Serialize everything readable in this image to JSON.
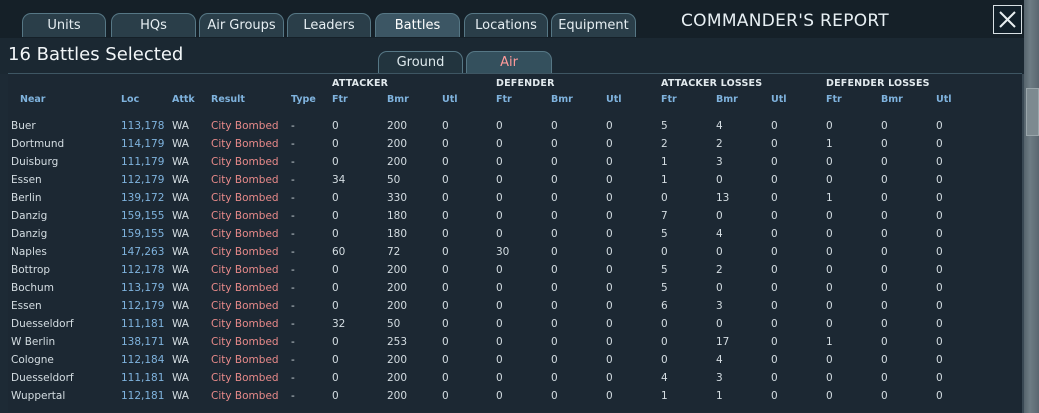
{
  "tabs": [
    {
      "label": "Units"
    },
    {
      "label": "HQs"
    },
    {
      "label": "Air Groups"
    },
    {
      "label": "Leaders"
    },
    {
      "label": "Battles"
    },
    {
      "label": "Locations"
    },
    {
      "label": "Equipment"
    }
  ],
  "active_tab": "Battles",
  "title": "COMMANDER'S REPORT",
  "selected_count": "16 Battles Selected",
  "subtabs": [
    {
      "label": "Ground"
    },
    {
      "label": "Air"
    }
  ],
  "active_subtab": "Air",
  "group_headers": {
    "attacker": "ATTACKER",
    "defender": "DEFENDER",
    "attacker_losses": "ATTACKER LOSSES",
    "defender_losses": "DEFENDER LOSSES"
  },
  "columns": {
    "near": "Near",
    "loc": "Loc",
    "attk": "Attk",
    "result": "Result",
    "type": "Type",
    "a_ftr": "Ftr",
    "a_bmr": "Bmr",
    "a_utl": "Utl",
    "d_ftr": "Ftr",
    "d_bmr": "Bmr",
    "d_utl": "Utl",
    "al_ftr": "Ftr",
    "al_bmr": "Bmr",
    "al_utl": "Utl",
    "dl_ftr": "Ftr",
    "dl_bmr": "Bmr",
    "dl_utl": "Utl"
  },
  "rows": [
    {
      "near": "Buer",
      "loc": "113,178",
      "attk": "WA",
      "result": "City Bombed",
      "type": "-",
      "a_ftr": "0",
      "a_bmr": "200",
      "a_utl": "0",
      "d_ftr": "0",
      "d_bmr": "0",
      "d_utl": "0",
      "al_ftr": "5",
      "al_bmr": "4",
      "al_utl": "0",
      "dl_ftr": "0",
      "dl_bmr": "0",
      "dl_utl": "0"
    },
    {
      "near": "Dortmund",
      "loc": "114,179",
      "attk": "WA",
      "result": "City Bombed",
      "type": "-",
      "a_ftr": "0",
      "a_bmr": "200",
      "a_utl": "0",
      "d_ftr": "0",
      "d_bmr": "0",
      "d_utl": "0",
      "al_ftr": "2",
      "al_bmr": "2",
      "al_utl": "0",
      "dl_ftr": "1",
      "dl_bmr": "0",
      "dl_utl": "0"
    },
    {
      "near": "Duisburg",
      "loc": "111,179",
      "attk": "WA",
      "result": "City Bombed",
      "type": "-",
      "a_ftr": "0",
      "a_bmr": "200",
      "a_utl": "0",
      "d_ftr": "0",
      "d_bmr": "0",
      "d_utl": "0",
      "al_ftr": "1",
      "al_bmr": "3",
      "al_utl": "0",
      "dl_ftr": "0",
      "dl_bmr": "0",
      "dl_utl": "0"
    },
    {
      "near": "Essen",
      "loc": "112,179",
      "attk": "WA",
      "result": "City Bombed",
      "type": "-",
      "a_ftr": "34",
      "a_bmr": "50",
      "a_utl": "0",
      "d_ftr": "0",
      "d_bmr": "0",
      "d_utl": "0",
      "al_ftr": "1",
      "al_bmr": "0",
      "al_utl": "0",
      "dl_ftr": "0",
      "dl_bmr": "0",
      "dl_utl": "0"
    },
    {
      "near": "Berlin",
      "loc": "139,172",
      "attk": "WA",
      "result": "City Bombed",
      "type": "-",
      "a_ftr": "0",
      "a_bmr": "330",
      "a_utl": "0",
      "d_ftr": "0",
      "d_bmr": "0",
      "d_utl": "0",
      "al_ftr": "0",
      "al_bmr": "13",
      "al_utl": "0",
      "dl_ftr": "1",
      "dl_bmr": "0",
      "dl_utl": "0"
    },
    {
      "near": "Danzig",
      "loc": "159,155",
      "attk": "WA",
      "result": "City Bombed",
      "type": "-",
      "a_ftr": "0",
      "a_bmr": "180",
      "a_utl": "0",
      "d_ftr": "0",
      "d_bmr": "0",
      "d_utl": "0",
      "al_ftr": "7",
      "al_bmr": "0",
      "al_utl": "0",
      "dl_ftr": "0",
      "dl_bmr": "0",
      "dl_utl": "0"
    },
    {
      "near": "Danzig",
      "loc": "159,155",
      "attk": "WA",
      "result": "City Bombed",
      "type": "-",
      "a_ftr": "0",
      "a_bmr": "180",
      "a_utl": "0",
      "d_ftr": "0",
      "d_bmr": "0",
      "d_utl": "0",
      "al_ftr": "5",
      "al_bmr": "4",
      "al_utl": "0",
      "dl_ftr": "0",
      "dl_bmr": "0",
      "dl_utl": "0"
    },
    {
      "near": "Naples",
      "loc": "147,263",
      "attk": "WA",
      "result": "City Bombed",
      "type": "-",
      "a_ftr": "60",
      "a_bmr": "72",
      "a_utl": "0",
      "d_ftr": "30",
      "d_bmr": "0",
      "d_utl": "0",
      "al_ftr": "0",
      "al_bmr": "0",
      "al_utl": "0",
      "dl_ftr": "0",
      "dl_bmr": "0",
      "dl_utl": "0"
    },
    {
      "near": "Bottrop",
      "loc": "112,178",
      "attk": "WA",
      "result": "City Bombed",
      "type": "-",
      "a_ftr": "0",
      "a_bmr": "200",
      "a_utl": "0",
      "d_ftr": "0",
      "d_bmr": "0",
      "d_utl": "0",
      "al_ftr": "5",
      "al_bmr": "2",
      "al_utl": "0",
      "dl_ftr": "0",
      "dl_bmr": "0",
      "dl_utl": "0"
    },
    {
      "near": "Bochum",
      "loc": "113,179",
      "attk": "WA",
      "result": "City Bombed",
      "type": "-",
      "a_ftr": "0",
      "a_bmr": "200",
      "a_utl": "0",
      "d_ftr": "0",
      "d_bmr": "0",
      "d_utl": "0",
      "al_ftr": "5",
      "al_bmr": "0",
      "al_utl": "0",
      "dl_ftr": "0",
      "dl_bmr": "0",
      "dl_utl": "0"
    },
    {
      "near": "Essen",
      "loc": "112,179",
      "attk": "WA",
      "result": "City Bombed",
      "type": "-",
      "a_ftr": "0",
      "a_bmr": "200",
      "a_utl": "0",
      "d_ftr": "0",
      "d_bmr": "0",
      "d_utl": "0",
      "al_ftr": "6",
      "al_bmr": "3",
      "al_utl": "0",
      "dl_ftr": "0",
      "dl_bmr": "0",
      "dl_utl": "0"
    },
    {
      "near": "Duesseldorf",
      "loc": "111,181",
      "attk": "WA",
      "result": "City Bombed",
      "type": "-",
      "a_ftr": "32",
      "a_bmr": "50",
      "a_utl": "0",
      "d_ftr": "0",
      "d_bmr": "0",
      "d_utl": "0",
      "al_ftr": "0",
      "al_bmr": "0",
      "al_utl": "0",
      "dl_ftr": "0",
      "dl_bmr": "0",
      "dl_utl": "0"
    },
    {
      "near": "W Berlin",
      "loc": "138,171",
      "attk": "WA",
      "result": "City Bombed",
      "type": "-",
      "a_ftr": "0",
      "a_bmr": "253",
      "a_utl": "0",
      "d_ftr": "0",
      "d_bmr": "0",
      "d_utl": "0",
      "al_ftr": "0",
      "al_bmr": "17",
      "al_utl": "0",
      "dl_ftr": "1",
      "dl_bmr": "0",
      "dl_utl": "0"
    },
    {
      "near": "Cologne",
      "loc": "112,184",
      "attk": "WA",
      "result": "City Bombed",
      "type": "-",
      "a_ftr": "0",
      "a_bmr": "200",
      "a_utl": "0",
      "d_ftr": "0",
      "d_bmr": "0",
      "d_utl": "0",
      "al_ftr": "0",
      "al_bmr": "4",
      "al_utl": "0",
      "dl_ftr": "0",
      "dl_bmr": "0",
      "dl_utl": "0"
    },
    {
      "near": "Duesseldorf",
      "loc": "111,181",
      "attk": "WA",
      "result": "City Bombed",
      "type": "-",
      "a_ftr": "0",
      "a_bmr": "200",
      "a_utl": "0",
      "d_ftr": "0",
      "d_bmr": "0",
      "d_utl": "0",
      "al_ftr": "4",
      "al_bmr": "3",
      "al_utl": "0",
      "dl_ftr": "0",
      "dl_bmr": "0",
      "dl_utl": "0"
    },
    {
      "near": "Wuppertal",
      "loc": "112,181",
      "attk": "WA",
      "result": "City Bombed",
      "type": "-",
      "a_ftr": "0",
      "a_bmr": "200",
      "a_utl": "0",
      "d_ftr": "0",
      "d_bmr": "0",
      "d_utl": "0",
      "al_ftr": "1",
      "al_bmr": "1",
      "al_utl": "0",
      "dl_ftr": "0",
      "dl_bmr": "0",
      "dl_utl": "0"
    }
  ],
  "colors": {
    "panel_bg": "#1d2a35",
    "header_blue": "#7fb3de",
    "result_red": "#e88a8a",
    "air_tab_text": "#ff9a9a"
  },
  "icons": {
    "close": "close-icon"
  }
}
